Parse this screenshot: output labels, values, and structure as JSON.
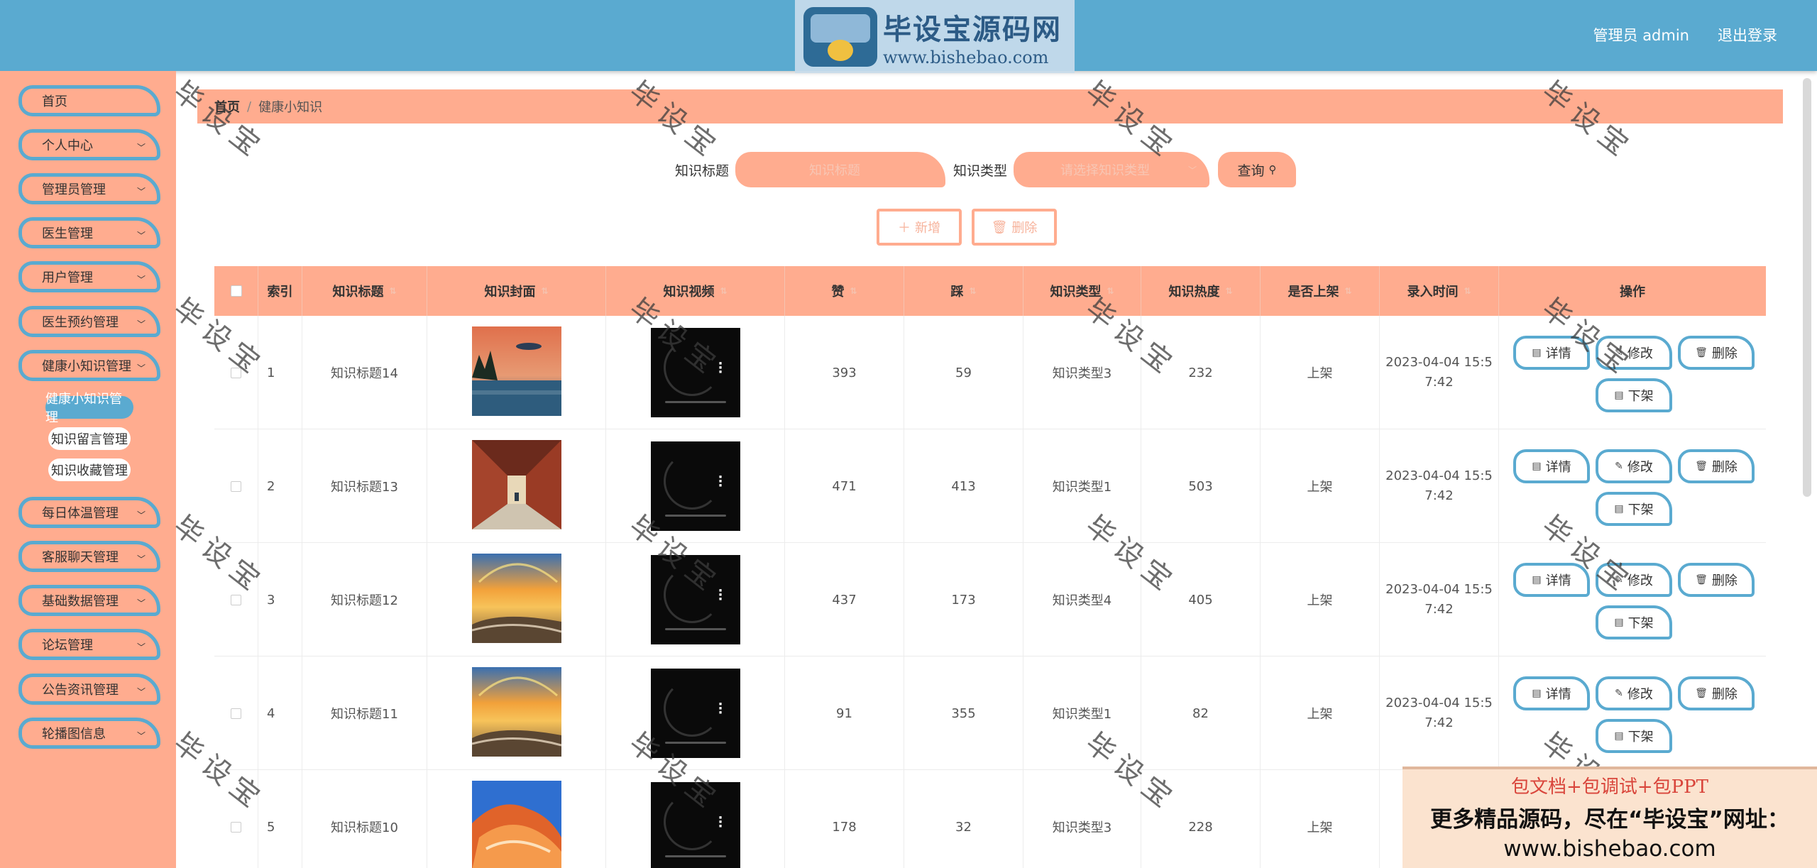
{
  "header": {
    "admin_label": "管理员 admin",
    "logout_label": "退出登录"
  },
  "logo_watermark": {
    "title": "毕设宝源码网",
    "url": "www.bishebao.com"
  },
  "sidebar": {
    "items": [
      {
        "label": "首页",
        "has_arrow": false
      },
      {
        "label": "个人中心",
        "has_arrow": true
      },
      {
        "label": "管理员管理",
        "has_arrow": true
      },
      {
        "label": "医生管理",
        "has_arrow": true
      },
      {
        "label": "用户管理",
        "has_arrow": true
      },
      {
        "label": "医生预约管理",
        "has_arrow": true
      },
      {
        "label": "健康小知识管理",
        "has_arrow": true
      },
      {
        "label": "每日体温管理",
        "has_arrow": true
      },
      {
        "label": "客服聊天管理",
        "has_arrow": true
      },
      {
        "label": "基础数据管理",
        "has_arrow": true
      },
      {
        "label": "论坛管理",
        "has_arrow": true
      },
      {
        "label": "公告资讯管理",
        "has_arrow": true
      },
      {
        "label": "轮播图信息",
        "has_arrow": true
      }
    ],
    "sub_items": [
      {
        "label": "健康小知识管理",
        "active": true
      },
      {
        "label": "知识留言管理",
        "active": false
      },
      {
        "label": "知识收藏管理",
        "active": false
      }
    ]
  },
  "breadcrumb": {
    "home": "首页",
    "separator": "/",
    "current": "健康小知识"
  },
  "search": {
    "title_label": "知识标题",
    "title_placeholder": "知识标题",
    "type_label": "知识类型",
    "type_placeholder": "请选择知识类型",
    "query_label": "查询"
  },
  "actions": {
    "add_label": "新增",
    "delete_label": "删除"
  },
  "table": {
    "columns": [
      "",
      "索引",
      "知识标题",
      "知识封面",
      "知识视频",
      "赞",
      "踩",
      "知识类型",
      "知识热度",
      "是否上架",
      "录入时间",
      "操作"
    ],
    "rows": [
      {
        "index": "1",
        "title": "知识标题14",
        "likes": "393",
        "dislikes": "59",
        "type": "知识类型3",
        "heat": "232",
        "status": "上架",
        "time_l1": "2023-04-04 15:5",
        "time_l2": "7:42",
        "cover": "lake-moon"
      },
      {
        "index": "2",
        "title": "知识标题13",
        "likes": "471",
        "dislikes": "413",
        "type": "知识类型1",
        "heat": "503",
        "status": "上架",
        "time_l1": "2023-04-04 15:5",
        "time_l2": "7:42",
        "cover": "corridor"
      },
      {
        "index": "3",
        "title": "知识标题12",
        "likes": "437",
        "dislikes": "173",
        "type": "知识类型4",
        "heat": "405",
        "status": "上架",
        "time_l1": "2023-04-04 15:5",
        "time_l2": "7:42",
        "cover": "sunset-beach"
      },
      {
        "index": "4",
        "title": "知识标题11",
        "likes": "91",
        "dislikes": "355",
        "type": "知识类型1",
        "heat": "82",
        "status": "上架",
        "time_l1": "2023-04-04 15:5",
        "time_l2": "7:42",
        "cover": "sunset-beach"
      },
      {
        "index": "5",
        "title": "知识标题10",
        "likes": "178",
        "dislikes": "32",
        "type": "知识类型3",
        "heat": "228",
        "status": "上架",
        "time_l1": "20",
        "time_l2": "",
        "cover": "red-rock"
      }
    ],
    "op_labels": {
      "detail": "详情",
      "edit": "修改",
      "delete": "删除",
      "offline": "下架"
    }
  },
  "watermark_text": "毕设宝",
  "promo": {
    "line1": "包文档+包调试+包PPT",
    "line2": "更多精品源码，尽在“毕设宝”网址：",
    "line3": "www.bishebao.com"
  }
}
